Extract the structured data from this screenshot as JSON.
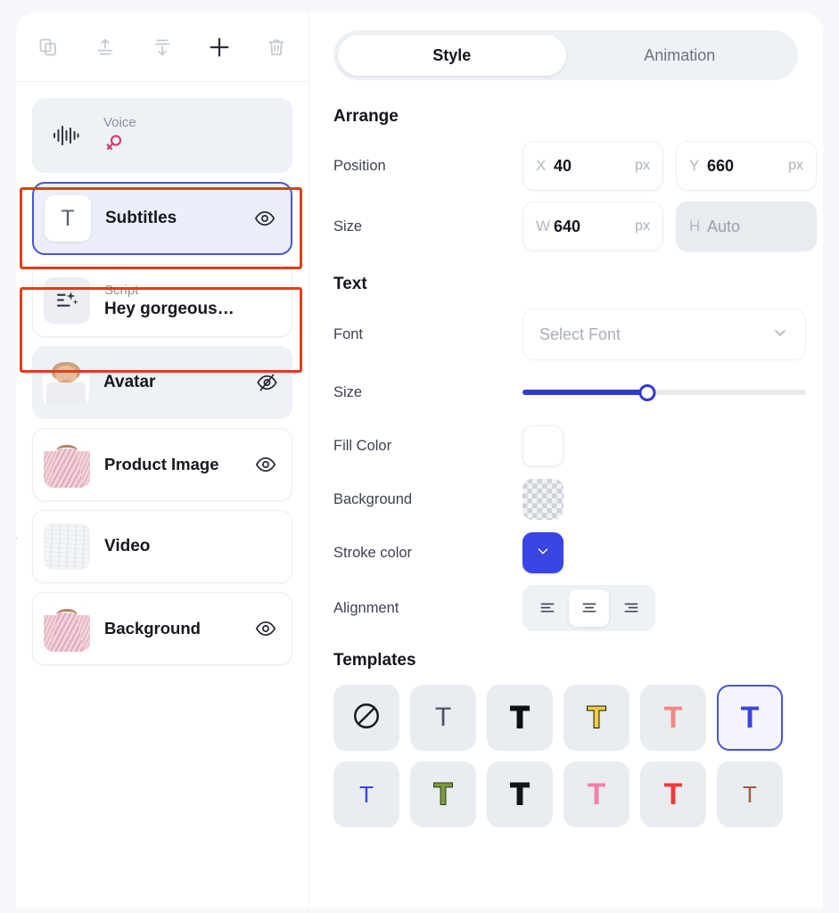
{
  "toolbar": {
    "items": [
      {
        "name": "duplicate-icon",
        "label": "Duplicate"
      },
      {
        "name": "bring-to-front-icon",
        "label": "Bring to front"
      },
      {
        "name": "send-to-back-icon",
        "label": "Send to back"
      },
      {
        "name": "add-icon",
        "label": "Add"
      },
      {
        "name": "delete-icon",
        "label": "Delete"
      }
    ]
  },
  "layers": {
    "items": [
      {
        "id": "voice",
        "sub": "Voice",
        "title": "",
        "thumb": "waveform",
        "eye": "none",
        "state": "muted",
        "gender": "female"
      },
      {
        "id": "subtitles",
        "sub": "",
        "title": "Subtitles",
        "thumb": "text-t",
        "eye": "visible",
        "state": "selected"
      },
      {
        "id": "script",
        "sub": "Script",
        "title": "Hey gorgeous…",
        "thumb": "script-ai",
        "eye": "none",
        "state": "plain"
      },
      {
        "id": "avatar",
        "sub": "",
        "title": "Avatar",
        "thumb": "avatar-photo",
        "eye": "hidden",
        "state": "muted"
      },
      {
        "id": "product-image",
        "sub": "",
        "title": "Product Image",
        "thumb": "dress-photo",
        "eye": "visible",
        "state": "plain"
      },
      {
        "id": "video",
        "sub": "",
        "title": "Video",
        "thumb": "fabric-photo",
        "eye": "none",
        "state": "plain"
      },
      {
        "id": "background",
        "sub": "",
        "title": "Background",
        "thumb": "dress-photo",
        "eye": "visible",
        "state": "plain"
      }
    ],
    "collapse_handle_icon": "chevron-right-icon"
  },
  "tabs": {
    "style": "Style",
    "animation": "Animation",
    "active": "Style"
  },
  "arrange": {
    "heading": "Arrange",
    "position_label": "Position",
    "size_label": "Size",
    "x_axis": "X",
    "x_value": "40",
    "x_unit": "px",
    "y_axis": "Y",
    "y_value": "660",
    "y_unit": "px",
    "w_axis": "W",
    "w_value": "640",
    "w_unit": "px",
    "h_axis": "H",
    "h_value": "Auto"
  },
  "text": {
    "heading": "Text",
    "font_label": "Font",
    "font_placeholder": "Select Font",
    "font_chevron_icon": "chevron-down-icon",
    "size_label": "Size",
    "size_percent": 44,
    "fill_color_label": "Fill Color",
    "fill_color_value": "#ffffff",
    "background_label": "Background",
    "background_value": "transparent",
    "stroke_color_label": "Stroke color",
    "stroke_color_value": "#3a45e3",
    "stroke_chevron_icon": "chevron-down-icon",
    "alignment_label": "Alignment",
    "alignment_options": [
      "left",
      "center",
      "right"
    ],
    "alignment_active": "center"
  },
  "templates": {
    "heading": "Templates",
    "items": [
      {
        "id": "none",
        "type": "none",
        "label": "No style"
      },
      {
        "id": "t-plain",
        "type": "glyph",
        "char": "T",
        "fill": "#4e5360",
        "stroke": "none",
        "weight": 400,
        "size": 30,
        "selected": false
      },
      {
        "id": "t-black-outline",
        "type": "glyph",
        "char": "T",
        "fill": "#0d0f14",
        "stroke": "#0d0f14",
        "weight": 700,
        "size": 34,
        "selected": false
      },
      {
        "id": "t-yellow",
        "type": "glyph",
        "char": "T",
        "fill": "#f2cf3e",
        "stroke": "#0d0f14",
        "weight": 700,
        "size": 34,
        "selected": false
      },
      {
        "id": "t-coral",
        "type": "glyph",
        "char": "T",
        "fill": "#f08a80",
        "stroke": "none",
        "weight": 700,
        "size": 34,
        "selected": false
      },
      {
        "id": "t-blue",
        "type": "glyph",
        "char": "T",
        "fill": "#3a45e3",
        "stroke": "none",
        "weight": 700,
        "size": 34,
        "selected": true
      },
      {
        "id": "t-blue-thin",
        "type": "glyph",
        "char": "T",
        "fill": "#3a45e3",
        "stroke": "none",
        "weight": 400,
        "size": 26,
        "selected": false
      },
      {
        "id": "t-green",
        "type": "glyph",
        "char": "T",
        "fill": "#7b9b3f",
        "stroke": "#2e3a18",
        "weight": 700,
        "size": 34,
        "selected": false
      },
      {
        "id": "t-black",
        "type": "glyph",
        "char": "T",
        "fill": "#12141a",
        "stroke": "#12141a",
        "weight": 700,
        "size": 34,
        "selected": false
      },
      {
        "id": "t-pink",
        "type": "glyph",
        "char": "T",
        "fill": "#f47fad",
        "stroke": "none",
        "weight": 700,
        "size": 34,
        "selected": false
      },
      {
        "id": "t-red",
        "type": "glyph",
        "char": "T",
        "fill": "#ef3b36",
        "stroke": "none",
        "weight": 700,
        "size": 34,
        "selected": false
      },
      {
        "id": "t-rust-thin",
        "type": "glyph",
        "char": "T",
        "fill": "#a05b3e",
        "stroke": "none",
        "weight": 400,
        "size": 26,
        "selected": false
      }
    ]
  },
  "colors": {
    "accent_blue": "#3a45e3",
    "selected_border": "#4a55d0",
    "annotation_red": "#e03e1a",
    "gender_pink": "#d63b6e",
    "page_bg": "#f7f7fb"
  },
  "annotations": [
    {
      "name": "highlight-subtitles"
    },
    {
      "name": "highlight-script"
    }
  ]
}
